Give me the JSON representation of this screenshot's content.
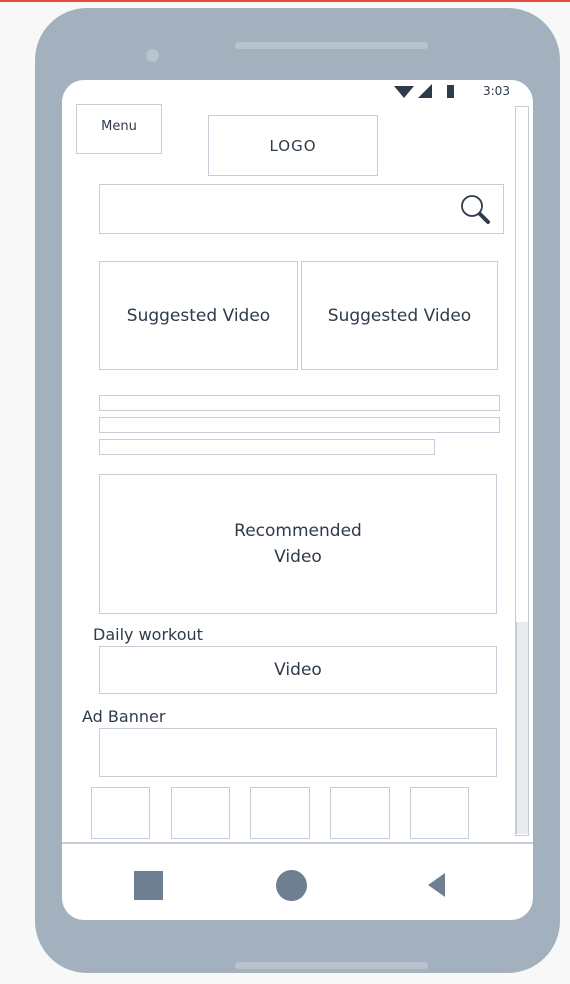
{
  "status_bar": {
    "time": "3:03"
  },
  "header": {
    "menu_label": "Menu",
    "logo_label": "LOGO"
  },
  "search": {
    "icon": "search-icon"
  },
  "suggested": [
    {
      "label": "Suggested Video"
    },
    {
      "label": "Suggested Video"
    }
  ],
  "recommended": {
    "line1": "Recommended",
    "line2": "Video"
  },
  "daily_workout": {
    "heading": "Daily workout",
    "video_label": "Video"
  },
  "ad": {
    "heading": "Ad Banner"
  },
  "nav": {
    "recent": "square-icon",
    "home": "circle-icon",
    "back": "back-triangle-icon"
  },
  "colors": {
    "phone_body": "#a3b1be",
    "wire_line": "#c5ced8",
    "nav_icon": "#6e7f91",
    "accent_top": "#e74c3c"
  }
}
